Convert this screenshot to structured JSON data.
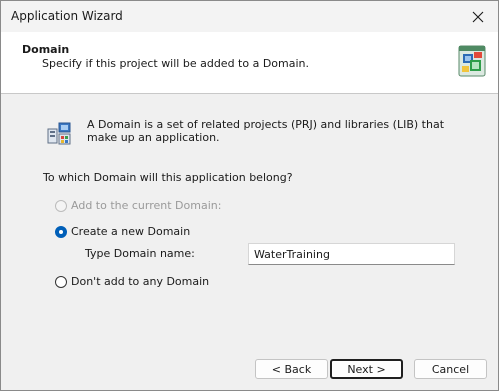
{
  "window": {
    "title": "Application Wizard"
  },
  "header": {
    "title": "Domain",
    "subtitle": "Specify if this project will be added to a Domain.",
    "icon": "wizard-page-icon"
  },
  "info": {
    "icon": "domain-icon",
    "text": "A Domain is a set of related projects (PRJ) and libraries (LIB) that make up an application."
  },
  "question": "To which Domain will this application belong?",
  "options": {
    "add_current": {
      "label": "Add to the current Domain:",
      "enabled": false,
      "selected": false
    },
    "create_new": {
      "label": "Create a new Domain",
      "enabled": true,
      "selected": true
    },
    "dont_add": {
      "label": "Don't add to any Domain",
      "enabled": true,
      "selected": false
    }
  },
  "domain_name": {
    "label": "Type Domain name:",
    "value": "WaterTraining"
  },
  "buttons": {
    "back": "< Back",
    "next": "Next >",
    "cancel": "Cancel"
  },
  "colors": {
    "accent": "#005fb8",
    "header_bg": "#ffffff",
    "dialog_bg": "#f0f0f0"
  }
}
